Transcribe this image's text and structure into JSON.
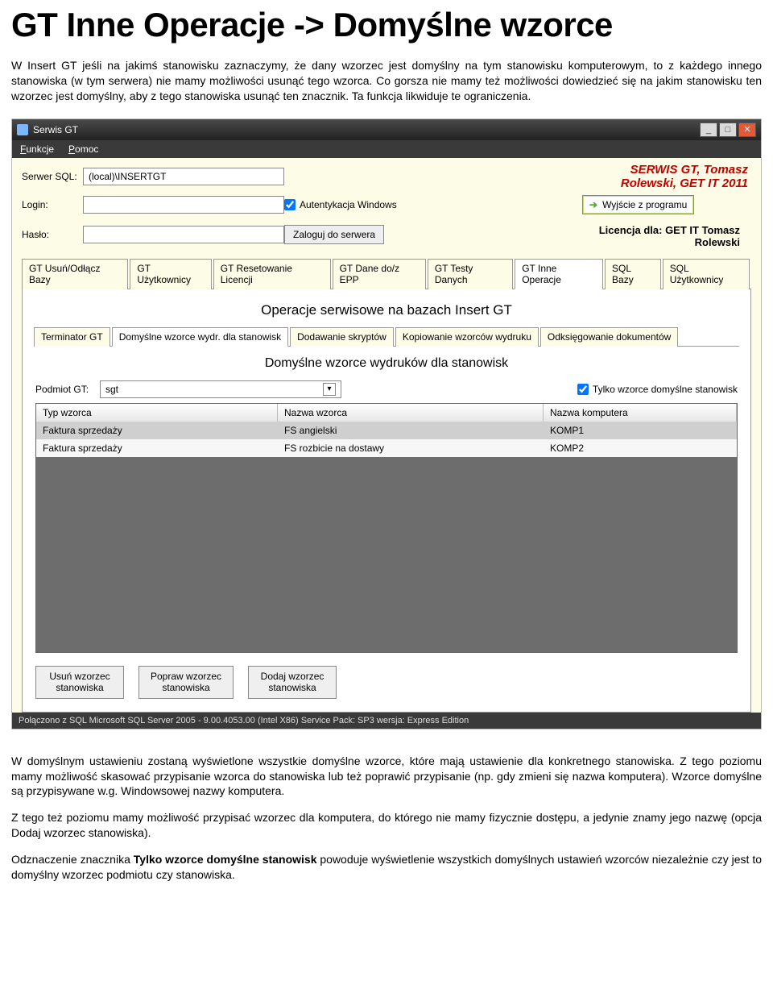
{
  "doc": {
    "title": "GT Inne Operacje -> Domyślne wzorce",
    "intro": "W Insert GT jeśli na jakimś stanowisku zaznaczymy, że dany wzorzec jest domyślny na tym stanowisku komputerowym, to z każdego innego stanowiska (w tym serwera) nie mamy możliwości usunąć tego wzorca. Co  gorsza nie mamy też możliwości dowiedzieć się na jakim stanowisku ten wzorzec jest domyślny, aby z tego stanowiska usunąć ten znacznik. Ta funkcja likwiduje te ograniczenia.",
    "p1": "W domyślnym ustawieniu zostaną wyświetlone wszystkie domyślne wzorce, które mają ustawienie dla konkretnego stanowiska. Z tego poziomu mamy możliwość skasować przypisanie wzorca do stanowiska lub też poprawić przypisanie (np. gdy zmieni się nazwa komputera). Wzorce domyślne są przypisywane w.g. Windowsowej nazwy komputera.",
    "p2": "Z tego też poziomu mamy możliwość przypisać wzorzec dla komputera, do którego nie mamy fizycznie dostępu, a jedynie znamy jego nazwę (opcja Dodaj wzorzec stanowiska).",
    "p3a": "Odznaczenie znacznika ",
    "p3b": "Tylko wzorce domyślne stanowisk",
    "p3c": " powoduje wyświetlenie wszystkich domyślnych ustawień wzorców niezależnie czy jest to domyślny wzorzec podmiotu czy stanowiska."
  },
  "app": {
    "window_title": "Serwis GT",
    "menu": {
      "funkcje": "Funkcje",
      "pomoc": "Pomoc"
    },
    "brand": "SERWIS GT, Tomasz Rolewski, GET IT 2011",
    "labels": {
      "serwer": "Serwer SQL:",
      "login": "Login:",
      "haslo": "Hasło:"
    },
    "fields": {
      "serwer": "(local)\\INSERTGT",
      "login": "",
      "haslo": ""
    },
    "auth_chk": "Autentykacja Windows",
    "login_btn": "Zaloguj do serwera",
    "exit_btn": "Wyjście z programu",
    "license": "Licencja dla: GET IT Tomasz Rolewski",
    "main_tabs": [
      "GT Usuń/Odłącz Bazy",
      "GT Użytkownicy",
      "GT Resetowanie Licencji",
      "GT Dane do/z EPP",
      "GT Testy Danych",
      "GT Inne Operacje",
      "SQL Bazy",
      "SQL Użytkownicy"
    ],
    "main_active": 5,
    "section_title_1": "Operacje serwisowe na bazach Insert GT",
    "sub_tabs": [
      "Terminator GT",
      "Domyślne wzorce wydr. dla stanowisk",
      "Dodawanie skryptów",
      "Kopiowanie wzorców wydruku",
      "Odksięgowanie dokumentów"
    ],
    "sub_active": 1,
    "section_title_2": "Domyślne wzorce wydruków dla stanowisk",
    "podmiot_lbl": "Podmiot GT:",
    "podmiot_val": "sgt",
    "only_chk": "Tylko wzorce domyślne stanowisk",
    "table": {
      "headers": [
        "Typ wzorca",
        "Nazwa wzorca",
        "Nazwa komputera"
      ],
      "rows": [
        [
          "Faktura sprzedaży",
          "FS angielski",
          "KOMP1"
        ],
        [
          "Faktura sprzedaży",
          "FS rozbicie na dostawy",
          "KOMP2"
        ]
      ]
    },
    "buttons": {
      "usun": "Usuń wzorzec\nstanowiska",
      "popraw": "Popraw wzorzec\nstanowiska",
      "dodaj": "Dodaj wzorzec\nstanowiska"
    },
    "status": "Połączono z SQL  Microsoft SQL Server 2005 - 9.00.4053.00 (Intel X86)   Service Pack: SP3  wersja: Express Edition"
  }
}
